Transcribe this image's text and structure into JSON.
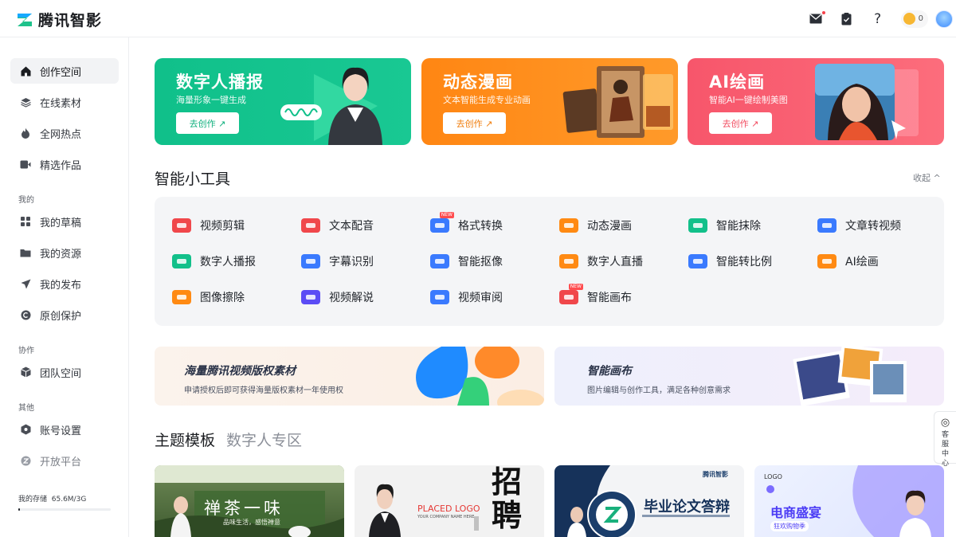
{
  "app": {
    "name": "腾讯智影"
  },
  "topbar": {
    "coin_count": "0"
  },
  "sidebar": {
    "items": [
      {
        "label": "创作空间",
        "icon": "home-icon"
      },
      {
        "label": "在线素材",
        "icon": "layers-icon"
      },
      {
        "label": "全网热点",
        "icon": "flame-icon"
      },
      {
        "label": "精选作品",
        "icon": "video-icon"
      }
    ],
    "section_mine": "我的",
    "mine_items": [
      {
        "label": "我的草稿",
        "icon": "grid-icon"
      },
      {
        "label": "我的资源",
        "icon": "folder-icon"
      },
      {
        "label": "我的发布",
        "icon": "send-icon"
      },
      {
        "label": "原创保护",
        "icon": "copyright-icon"
      }
    ],
    "section_collab": "协作",
    "collab_items": [
      {
        "label": "团队空间",
        "icon": "cube-icon"
      }
    ],
    "section_other": "其他",
    "other_items": [
      {
        "label": "账号设置",
        "icon": "settings-icon"
      },
      {
        "label": "开放平台",
        "icon": "platform-icon"
      }
    ],
    "storage_label": "我的存储",
    "storage_value": "65.6M/3G",
    "storage_fraction": 0.02
  },
  "banners": [
    {
      "title": "数字人播报",
      "subtitle": "海量形象一键生成",
      "button": "去创作 ↗",
      "color": "#12c08a"
    },
    {
      "title": "动态漫画",
      "subtitle": "文本智能生成专业动画",
      "button": "去创作 ↗",
      "color": "#ff8a13"
    },
    {
      "title": "AI绘画",
      "subtitle": "智能AI一键绘制美图",
      "button": "去创作 ↗",
      "color": "#f95a6d"
    }
  ],
  "tools_section": {
    "title": "智能小工具",
    "collapse_label": "收起 ^"
  },
  "tools": [
    {
      "label": "视频剪辑",
      "icon": "scissors-icon",
      "color": "#f0474b"
    },
    {
      "label": "文本配音",
      "icon": "text-voice-icon",
      "color": "#f0474b"
    },
    {
      "label": "格式转换",
      "icon": "convert-icon",
      "color": "#3a7afe",
      "new": "NEW"
    },
    {
      "label": "动态漫画",
      "icon": "comic-icon",
      "color": "#ff8a13"
    },
    {
      "label": "智能抹除",
      "icon": "erase-icon",
      "color": "#12c08a"
    },
    {
      "label": "文章转视频",
      "icon": "article-video-icon",
      "color": "#3a7afe"
    },
    {
      "label": "数字人播报",
      "icon": "avatar-broadcast-icon",
      "color": "#12c08a"
    },
    {
      "label": "字幕识别",
      "icon": "subtitle-icon",
      "color": "#3a7afe"
    },
    {
      "label": "智能抠像",
      "icon": "cutout-icon",
      "color": "#3a7afe"
    },
    {
      "label": "数字人直播",
      "icon": "live-icon",
      "color": "#ff8a13"
    },
    {
      "label": "智能转比例",
      "icon": "ratio-icon",
      "color": "#3a7afe"
    },
    {
      "label": "AI绘画",
      "icon": "palette-icon",
      "color": "#ff8a13"
    },
    {
      "label": "图像擦除",
      "icon": "image-erase-icon",
      "color": "#ff8a13"
    },
    {
      "label": "视频解说",
      "icon": "video-narrate-icon",
      "color": "#5b4cf5"
    },
    {
      "label": "视频审阅",
      "icon": "review-icon",
      "color": "#3a7afe"
    },
    {
      "label": "智能画布",
      "icon": "canvas-icon",
      "color": "#f0474b",
      "new": "NEW"
    }
  ],
  "promos": [
    {
      "title": "海量腾讯视频版权素材",
      "subtitle": "申请授权后即可获得海量版权素材一年使用权"
    },
    {
      "title": "智能画布",
      "subtitle": "图片编辑与创作工具，满足各种创意需求"
    }
  ],
  "templates": {
    "tab_active": "主题模板",
    "tab_inactive": "数字人专区",
    "cards": [
      {
        "big_text": "禅茶一味",
        "small_text": "品味生活，感悟禅意"
      },
      {
        "big_text": "招聘",
        "small_text": "PLACED LOGO",
        "small_text2": "YOUR COMPANY NAME HERE"
      },
      {
        "big_text": "毕业论文答辩",
        "brand": "腾讯智影"
      },
      {
        "big_text": "电商盛宴",
        "logo": "LOGO",
        "small_text": "狂欢购物季"
      }
    ]
  },
  "customer_service": {
    "label": "客服中心"
  }
}
